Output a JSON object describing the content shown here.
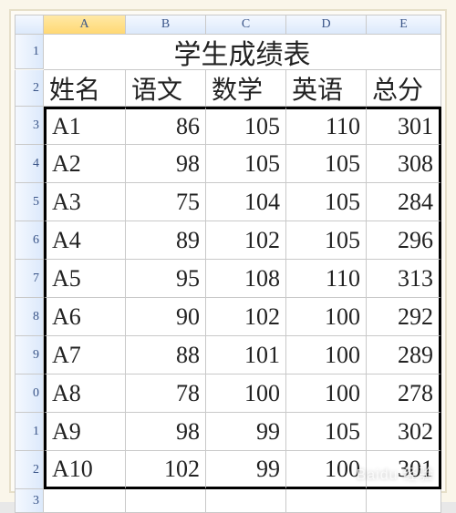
{
  "columns": [
    "A",
    "B",
    "C",
    "D",
    "E"
  ],
  "row_numbers": [
    "1",
    "2",
    "3",
    "4",
    "5",
    "6",
    "7",
    "8",
    "9",
    "0",
    "1",
    "2",
    "3"
  ],
  "title": "学生成绩表",
  "headers": {
    "name": "姓名",
    "chinese": "语文",
    "math": "数学",
    "english": "英语",
    "total": "总分"
  },
  "rows": [
    {
      "name": "A1",
      "chinese": 86,
      "math": 105,
      "english": 110,
      "total": 301
    },
    {
      "name": "A2",
      "chinese": 98,
      "math": 105,
      "english": 105,
      "total": 308
    },
    {
      "name": "A3",
      "chinese": 75,
      "math": 104,
      "english": 105,
      "total": 284
    },
    {
      "name": "A4",
      "chinese": 89,
      "math": 102,
      "english": 105,
      "total": 296
    },
    {
      "name": "A5",
      "chinese": 95,
      "math": 108,
      "english": 110,
      "total": 313
    },
    {
      "name": "A6",
      "chinese": 90,
      "math": 102,
      "english": 100,
      "total": 292
    },
    {
      "name": "A7",
      "chinese": 88,
      "math": 101,
      "english": 100,
      "total": 289
    },
    {
      "name": "A8",
      "chinese": 78,
      "math": 100,
      "english": 100,
      "total": 278
    },
    {
      "name": "A9",
      "chinese": 98,
      "math": 99,
      "english": 105,
      "total": 302
    },
    {
      "name": "A10",
      "chinese": 102,
      "math": 99,
      "english": 100,
      "total": 301
    }
  ],
  "selected_column_index": 0,
  "watermark": "Baidu 经验",
  "chart_data": {
    "type": "table",
    "title": "学生成绩表",
    "columns": [
      "姓名",
      "语文",
      "数学",
      "英语",
      "总分"
    ],
    "data": [
      [
        "A1",
        86,
        105,
        110,
        301
      ],
      [
        "A2",
        98,
        105,
        105,
        308
      ],
      [
        "A3",
        75,
        104,
        105,
        284
      ],
      [
        "A4",
        89,
        102,
        105,
        296
      ],
      [
        "A5",
        95,
        108,
        110,
        313
      ],
      [
        "A6",
        90,
        102,
        100,
        292
      ],
      [
        "A7",
        88,
        101,
        100,
        289
      ],
      [
        "A8",
        78,
        100,
        100,
        278
      ],
      [
        "A9",
        98,
        99,
        105,
        302
      ],
      [
        "A10",
        102,
        99,
        100,
        301
      ]
    ]
  }
}
